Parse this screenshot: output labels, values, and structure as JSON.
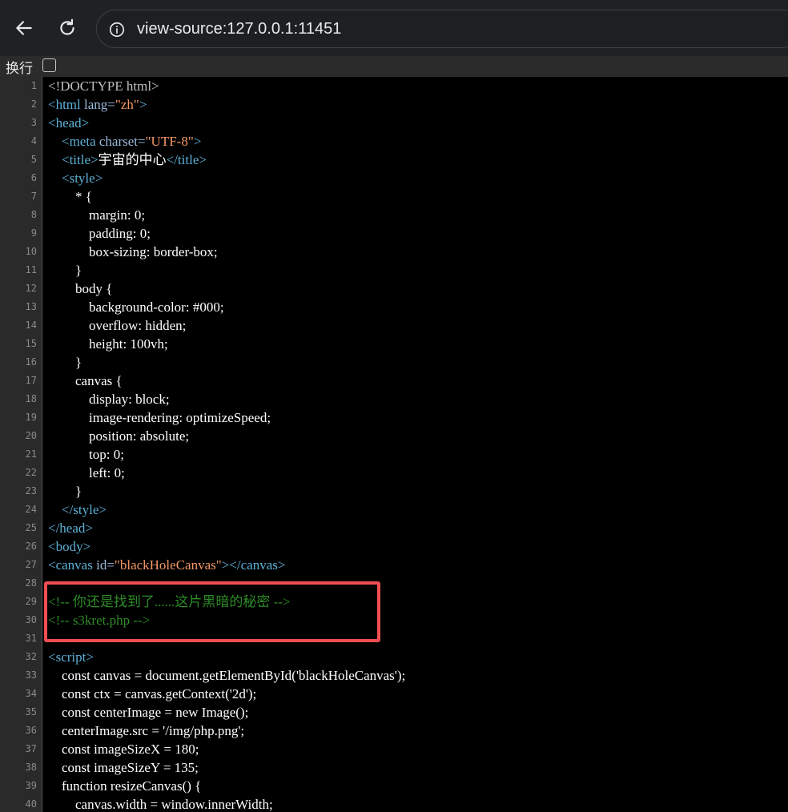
{
  "browser": {
    "url": "view-source:127.0.0.1:11451"
  },
  "wrap_option": {
    "label": "换行",
    "checked": false
  },
  "icons": {
    "back": "arrow-left-icon",
    "reload": "reload-icon",
    "site_info": "info-circle-icon"
  },
  "colors": {
    "tag": "#5db0d7",
    "attr": "#9bbbdc",
    "value": "#f29766",
    "comment": "#2e8b27",
    "highlight": "#ef4e52"
  },
  "lines": [
    {
      "n": "1",
      "t": [
        {
          "c": "tok-doc",
          "s": "<!DOCTYPE html>"
        }
      ]
    },
    {
      "n": "2",
      "t": [
        {
          "c": "tok-tag",
          "s": "<html "
        },
        {
          "c": "tok-attr",
          "s": "lang="
        },
        {
          "c": "tok-val",
          "s": "\"zh\""
        },
        {
          "c": "tok-tag",
          "s": ">"
        }
      ]
    },
    {
      "n": "3",
      "t": [
        {
          "c": "tok-tag",
          "s": "<head>"
        }
      ]
    },
    {
      "n": "4",
      "t": [
        {
          "c": "tok-txt",
          "s": "    "
        },
        {
          "c": "tok-tag",
          "s": "<meta "
        },
        {
          "c": "tok-attr",
          "s": "charset="
        },
        {
          "c": "tok-val",
          "s": "\"UTF-8\""
        },
        {
          "c": "tok-tag",
          "s": ">"
        }
      ]
    },
    {
      "n": "5",
      "t": [
        {
          "c": "tok-txt",
          "s": "    "
        },
        {
          "c": "tok-tag",
          "s": "<title>"
        },
        {
          "c": "tok-txt",
          "s": "宇宙的中心"
        },
        {
          "c": "tok-tag",
          "s": "</title>"
        }
      ]
    },
    {
      "n": "6",
      "t": [
        {
          "c": "tok-txt",
          "s": "    "
        },
        {
          "c": "tok-tag",
          "s": "<style>"
        }
      ]
    },
    {
      "n": "7",
      "t": [
        {
          "c": "tok-txt",
          "s": "        * {"
        }
      ]
    },
    {
      "n": "8",
      "t": [
        {
          "c": "tok-txt",
          "s": "            margin: 0;"
        }
      ]
    },
    {
      "n": "9",
      "t": [
        {
          "c": "tok-txt",
          "s": "            padding: 0;"
        }
      ]
    },
    {
      "n": "10",
      "t": [
        {
          "c": "tok-txt",
          "s": "            box-sizing: border-box;"
        }
      ]
    },
    {
      "n": "11",
      "t": [
        {
          "c": "tok-txt",
          "s": "        }"
        }
      ]
    },
    {
      "n": "12",
      "t": [
        {
          "c": "tok-txt",
          "s": "        body {"
        }
      ]
    },
    {
      "n": "13",
      "t": [
        {
          "c": "tok-txt",
          "s": "            background-color: #000;"
        }
      ]
    },
    {
      "n": "14",
      "t": [
        {
          "c": "tok-txt",
          "s": "            overflow: hidden;"
        }
      ]
    },
    {
      "n": "15",
      "t": [
        {
          "c": "tok-txt",
          "s": "            height: 100vh;"
        }
      ]
    },
    {
      "n": "16",
      "t": [
        {
          "c": "tok-txt",
          "s": "        }"
        }
      ]
    },
    {
      "n": "17",
      "t": [
        {
          "c": "tok-txt",
          "s": "        canvas {"
        }
      ]
    },
    {
      "n": "18",
      "t": [
        {
          "c": "tok-txt",
          "s": "            display: block;"
        }
      ]
    },
    {
      "n": "19",
      "t": [
        {
          "c": "tok-txt",
          "s": "            image-rendering: optimizeSpeed;"
        }
      ]
    },
    {
      "n": "20",
      "t": [
        {
          "c": "tok-txt",
          "s": "            position: absolute;"
        }
      ]
    },
    {
      "n": "21",
      "t": [
        {
          "c": "tok-txt",
          "s": "            top: 0;"
        }
      ]
    },
    {
      "n": "22",
      "t": [
        {
          "c": "tok-txt",
          "s": "            left: 0;"
        }
      ]
    },
    {
      "n": "23",
      "t": [
        {
          "c": "tok-txt",
          "s": "        }"
        }
      ]
    },
    {
      "n": "24",
      "t": [
        {
          "c": "tok-txt",
          "s": "    "
        },
        {
          "c": "tok-tag",
          "s": "</style>"
        }
      ]
    },
    {
      "n": "25",
      "t": [
        {
          "c": "tok-tag",
          "s": "</head>"
        }
      ]
    },
    {
      "n": "26",
      "t": [
        {
          "c": "tok-tag",
          "s": "<body>"
        }
      ]
    },
    {
      "n": "27",
      "t": [
        {
          "c": "tok-tag",
          "s": "<canvas "
        },
        {
          "c": "tok-attr",
          "s": "id="
        },
        {
          "c": "tok-val",
          "s": "\"blackHoleCanvas\""
        },
        {
          "c": "tok-tag",
          "s": "></canvas>"
        }
      ]
    },
    {
      "n": "28",
      "t": []
    },
    {
      "n": "29",
      "t": [
        {
          "c": "tok-com",
          "s": "<!-- 你还是找到了......这片黑暗的秘密 -->"
        }
      ]
    },
    {
      "n": "30",
      "t": [
        {
          "c": "tok-com",
          "s": "<!-- s3kret.php -->"
        }
      ]
    },
    {
      "n": "31",
      "t": []
    },
    {
      "n": "32",
      "t": [
        {
          "c": "tok-tag",
          "s": "<script>"
        }
      ]
    },
    {
      "n": "33",
      "t": [
        {
          "c": "tok-txt",
          "s": "    const canvas = document.getElementById('blackHoleCanvas');"
        }
      ]
    },
    {
      "n": "34",
      "t": [
        {
          "c": "tok-txt",
          "s": "    const ctx = canvas.getContext('2d');"
        }
      ]
    },
    {
      "n": "35",
      "t": [
        {
          "c": "tok-txt",
          "s": "    const centerImage = new Image();"
        }
      ]
    },
    {
      "n": "36",
      "t": [
        {
          "c": "tok-txt",
          "s": "    centerImage.src = '/img/php.png';"
        }
      ]
    },
    {
      "n": "37",
      "t": [
        {
          "c": "tok-txt",
          "s": "    const imageSizeX = 180;"
        }
      ]
    },
    {
      "n": "38",
      "t": [
        {
          "c": "tok-txt",
          "s": "    const imageSizeY = 135;"
        }
      ]
    },
    {
      "n": "39",
      "t": [
        {
          "c": "tok-txt",
          "s": "    function resizeCanvas() {"
        }
      ]
    },
    {
      "n": "40",
      "t": [
        {
          "c": "tok-txt",
          "s": "        canvas.width = window.innerWidth;"
        }
      ]
    }
  ]
}
